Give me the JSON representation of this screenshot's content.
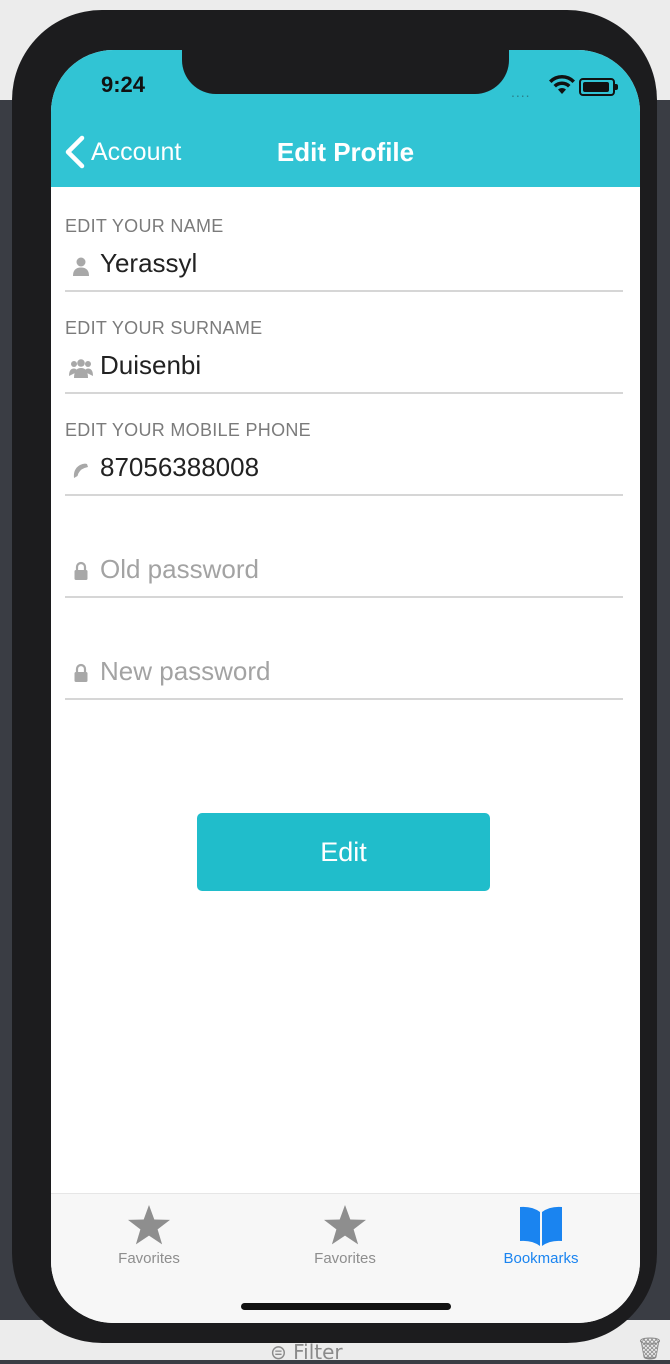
{
  "status_bar": {
    "time": "9:24",
    "signal": "...."
  },
  "nav": {
    "back_label": "Account",
    "title": "Edit Profile"
  },
  "form": {
    "name": {
      "label": "EDIT YOUR NAME",
      "value": "Yerassyl",
      "icon": "user-icon"
    },
    "surname": {
      "label": "EDIT YOUR SURNAME",
      "value": "Duisenbi",
      "icon": "users-icon"
    },
    "phone": {
      "label": "EDIT YOUR MOBILE PHONE",
      "value": "87056388008",
      "icon": "phone-icon"
    },
    "old_password": {
      "placeholder": "Old password",
      "icon": "lock-icon"
    },
    "new_password": {
      "placeholder": "New password",
      "icon": "lock-icon"
    },
    "submit_label": "Edit"
  },
  "tabs": [
    {
      "label": "Favorites",
      "icon": "star-icon",
      "active": false
    },
    {
      "label": "Favorites",
      "icon": "star-icon",
      "active": false
    },
    {
      "label": "Bookmarks",
      "icon": "book-icon",
      "active": true
    }
  ],
  "background": {
    "filter_label": "Filter"
  },
  "colors": {
    "header": "#31c4d4",
    "button": "#20bdcb",
    "active_tab": "#1a84f0",
    "inactive_tab": "#8e8e8e"
  }
}
